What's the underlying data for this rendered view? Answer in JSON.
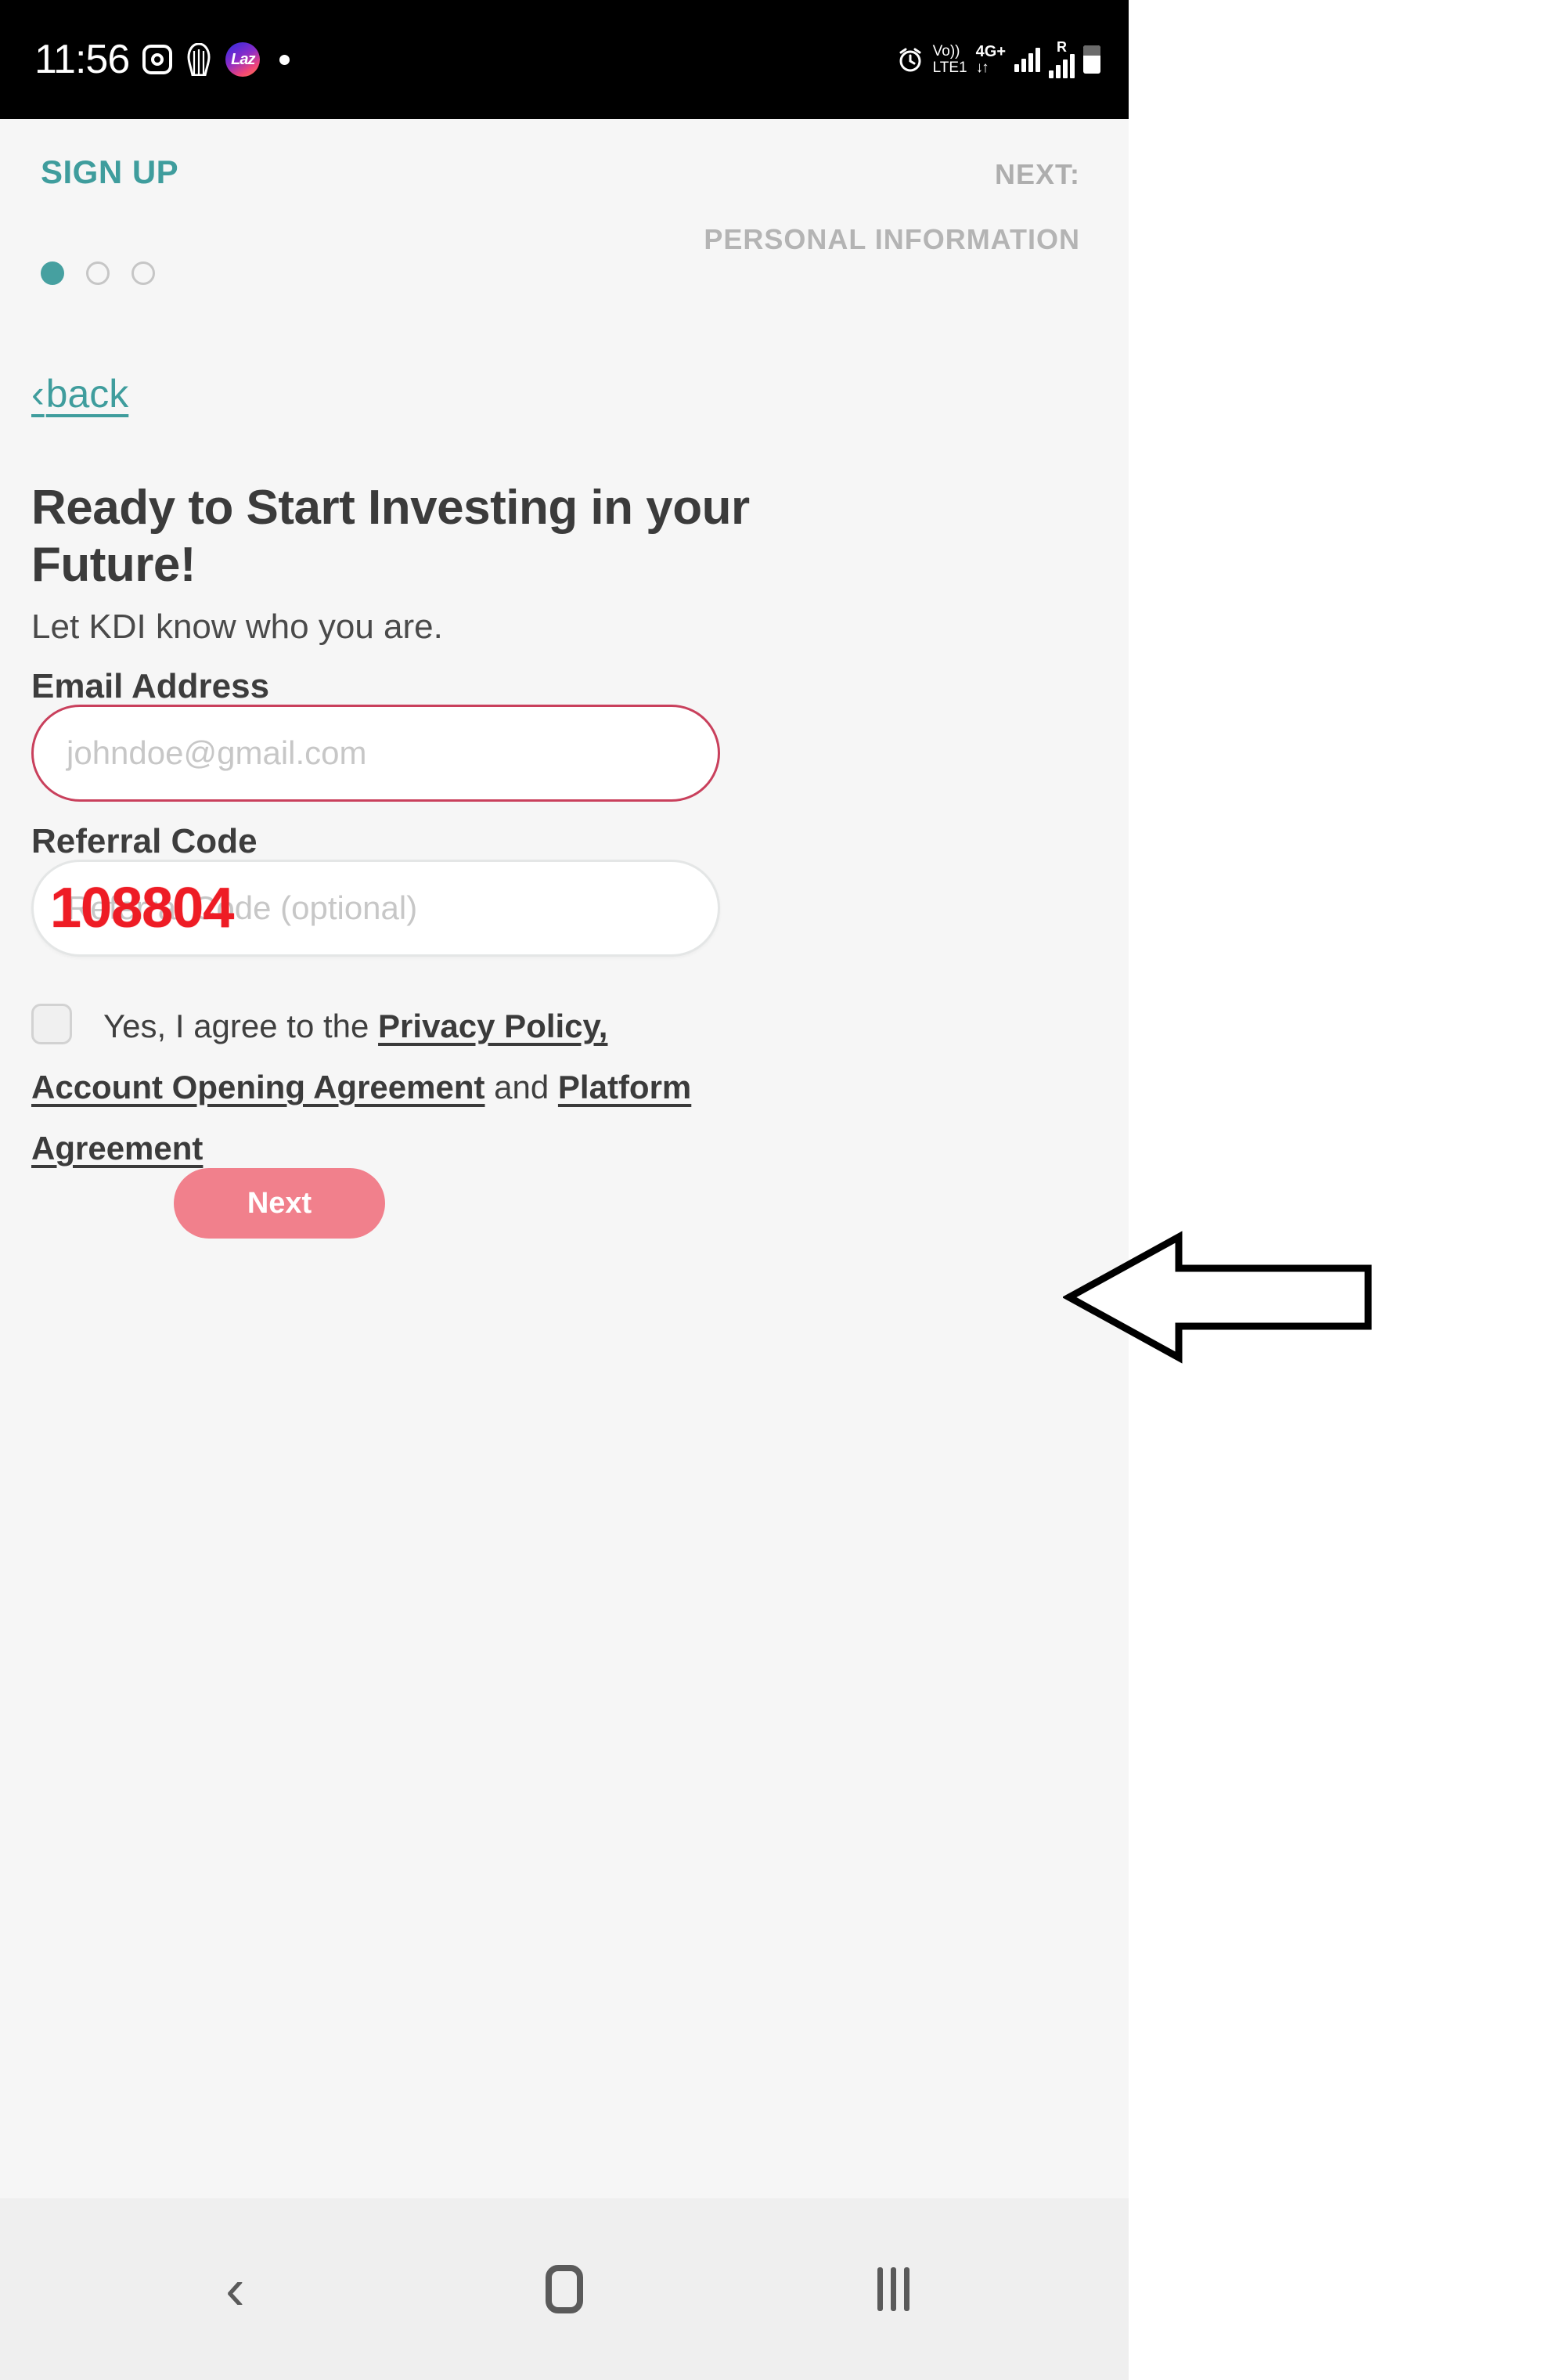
{
  "status_bar": {
    "time": "11:56",
    "left_icons": [
      "instagram-icon",
      "shell-app-icon",
      "lazada-icon",
      "notification-dot"
    ],
    "lazada_glyph": "Laz",
    "alarm_icon": "alarm-icon",
    "volte_line1": "Vo))",
    "volte_line2": "LTE1",
    "network_label": "4G+",
    "data_arrows": "↓↑",
    "roaming_label": "R",
    "signal_icon": "signal-bars-icon",
    "roaming_signal_icon": "roaming-signal-bars-icon",
    "battery_icon": "battery-icon"
  },
  "header": {
    "brand_title": "SIGN UP",
    "next_label": "NEXT:",
    "next_step_name": "PERSONAL INFORMATION",
    "steps": [
      {
        "state": "active"
      },
      {
        "state": "inactive"
      },
      {
        "state": "inactive"
      }
    ],
    "accent_color": "#3f9d9d",
    "muted_color": "#aeaeae"
  },
  "back_link": {
    "chevron": "‹",
    "label": "back"
  },
  "main": {
    "title": "Ready to Start Investing in your Future!",
    "subtitle": "Let KDI know who you are."
  },
  "form": {
    "email": {
      "label": "Email Address",
      "placeholder": "johndoe@gmail.com",
      "value": "",
      "border_color": "#c9405c"
    },
    "referral": {
      "label": "Referral Code",
      "placeholder": "Referral Code (optional)",
      "value": "",
      "border_color": "#e4e6e6"
    },
    "agreement": {
      "checked": false,
      "intro": "Yes, I agree to the ",
      "link_privacy": "Privacy Policy,",
      "link_account": "Account Opening Agreement",
      "conjunction": " and ",
      "link_platform": "Platform Agreement"
    },
    "submit": {
      "label": "Next",
      "color": "#f1808c"
    }
  },
  "annotation": {
    "referral_code_value": "108804",
    "referral_code_color": "#ee1c25",
    "arrow_direction": "left",
    "arrow_color": "#000000"
  },
  "nav_bar": {
    "back_icon": "‹",
    "home_icon": "home-icon",
    "recents_icon": "recents-icon"
  }
}
